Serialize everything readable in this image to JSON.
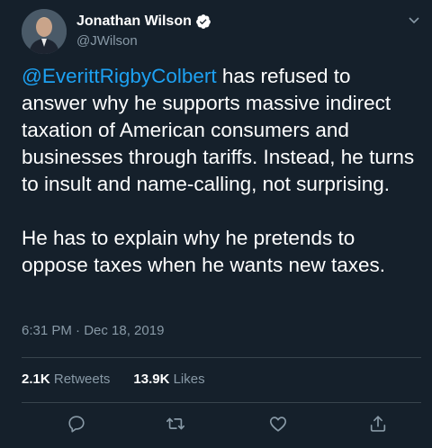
{
  "user": {
    "name": "Jonathan Wilson",
    "handle": "@JWilson"
  },
  "tweet": {
    "mention": "@EverittRigbyColbert",
    "para1_rest": " has refused to answer why he supports massive indirect taxation of American consumers and businesses through tariffs. Instead, he turns to insult and name-calling, not surprising.",
    "para2": "He has to explain why he pretends to oppose taxes when he wants new taxes.",
    "timestamp": "6:31 PM · Dec 18, 2019"
  },
  "stats": {
    "retweets_count": "2.1K",
    "retweets_label": "Retweets",
    "likes_count": "13.9K",
    "likes_label": "Likes"
  },
  "icons": [
    "verified-icon",
    "chevron-down-icon",
    "reply-icon",
    "retweet-icon",
    "like-icon",
    "share-icon"
  ],
  "colors": {
    "background": "#15202b",
    "accent": "#1da1f2",
    "muted": "#8899a6"
  }
}
